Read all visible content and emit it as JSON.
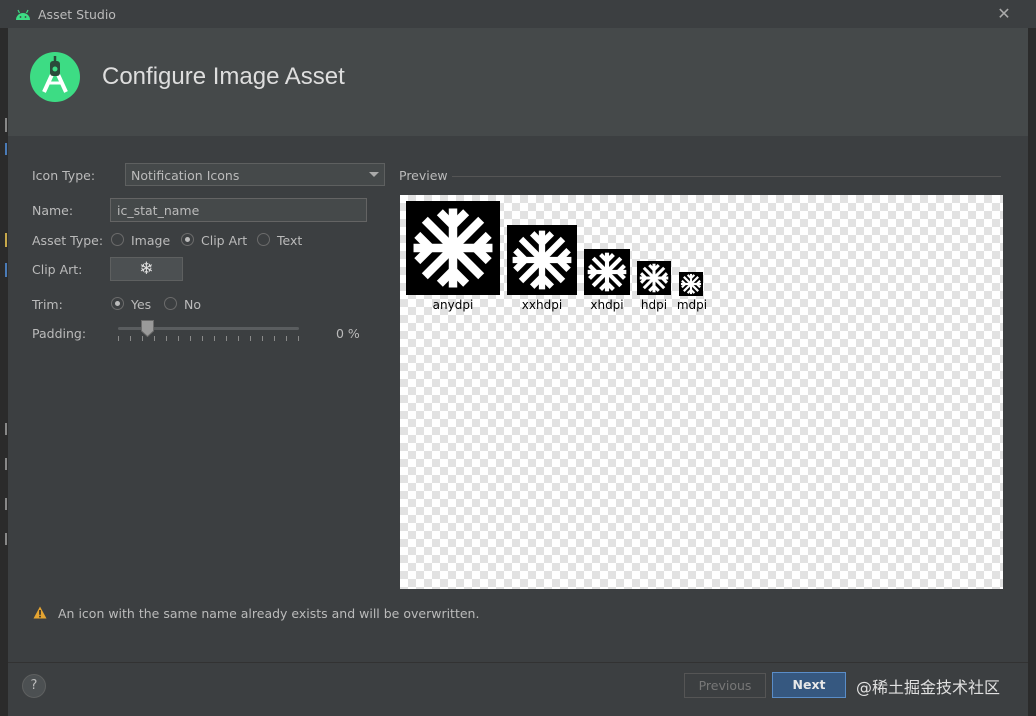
{
  "window": {
    "title": "Asset Studio"
  },
  "dialog": {
    "title": "Configure Image Asset"
  },
  "form": {
    "icon_type_label": "Icon Type:",
    "icon_type_value": "Notification Icons",
    "name_label": "Name:",
    "name_value": "ic_stat_name",
    "asset_type_label": "Asset Type:",
    "asset_type_options": [
      "Image",
      "Clip Art",
      "Text"
    ],
    "asset_type_selected": "Clip Art",
    "clip_art_label": "Clip Art:",
    "clip_art_icon": "snowflake-icon",
    "trim_label": "Trim:",
    "trim_options": [
      "Yes",
      "No"
    ],
    "trim_selected": "Yes",
    "padding_label": "Padding:",
    "padding_value": "0 %",
    "padding_percent": 0
  },
  "preview": {
    "label": "Preview",
    "densities": [
      "anydpi",
      "xxhdpi",
      "xhdpi",
      "hdpi",
      "mdpi"
    ]
  },
  "warning": {
    "text": "An icon with the same name already exists and will be overwritten.",
    "color": "#e5a431"
  },
  "footer": {
    "help_label": "?",
    "previous_label": "Previous",
    "next_label": "Next"
  },
  "watermark": {
    "text": "@稀土掘金技术社区"
  },
  "colors": {
    "accent": "#365880",
    "android_green": "#3ddc84"
  }
}
